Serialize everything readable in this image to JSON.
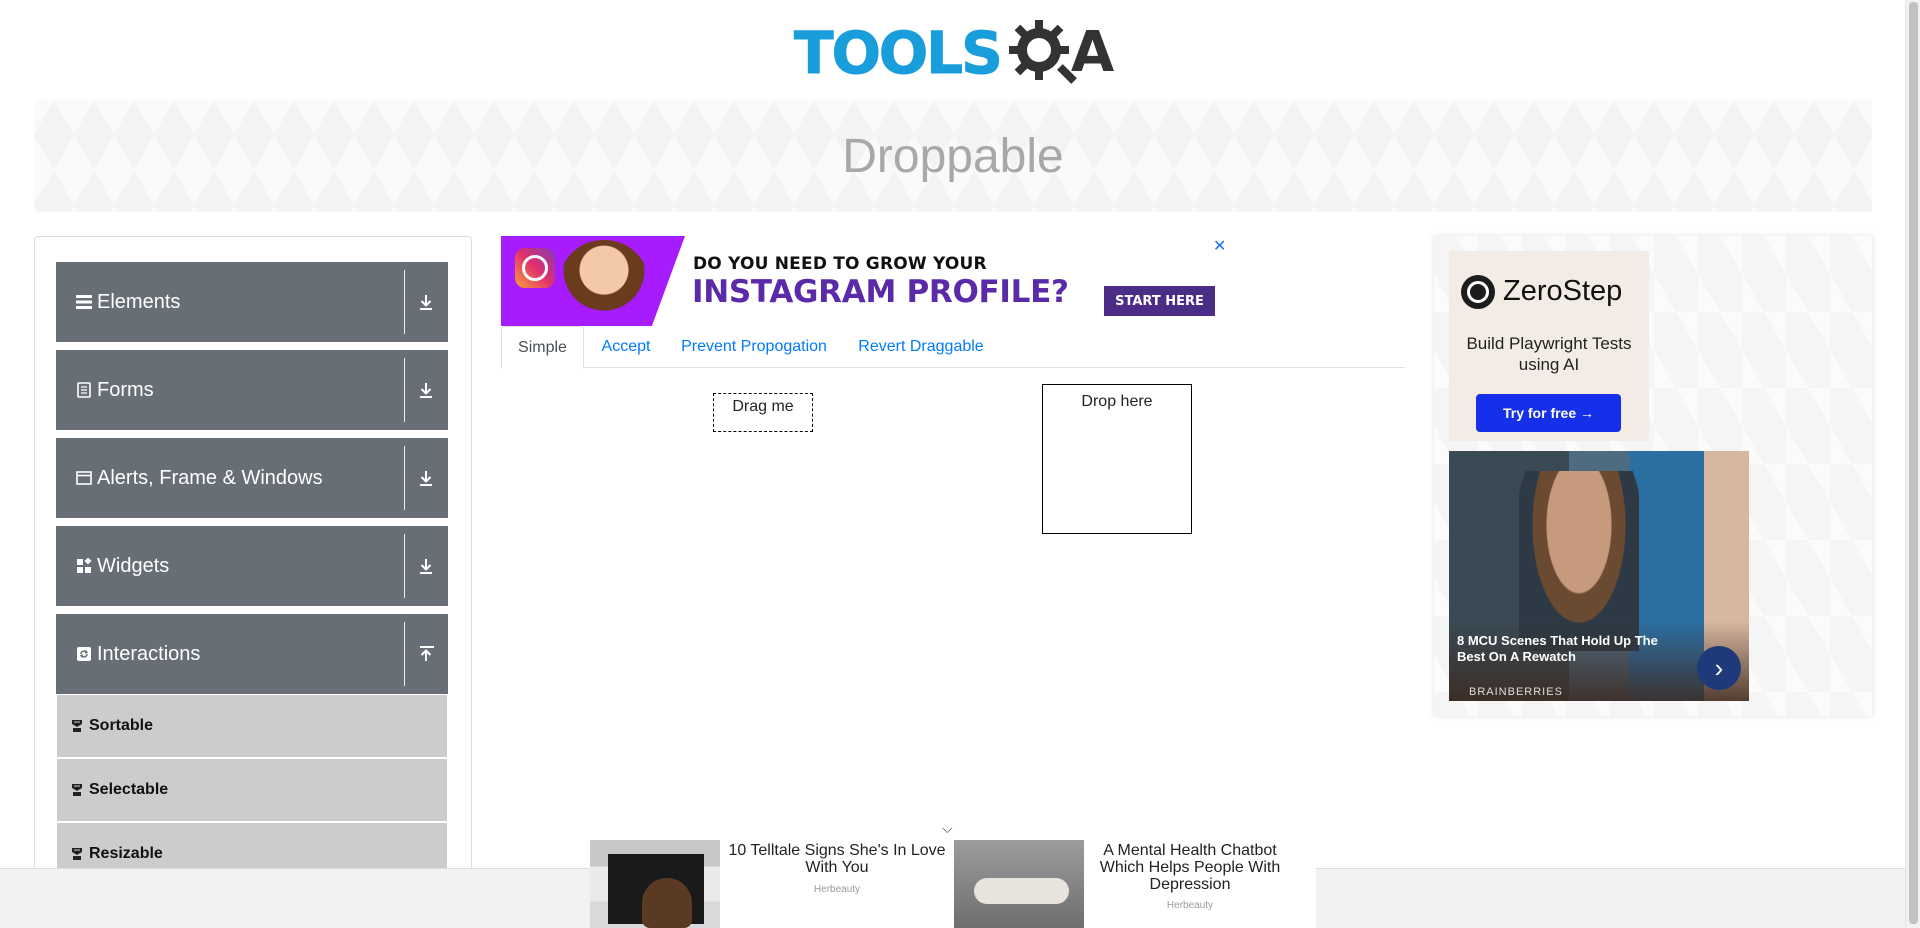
{
  "header": {
    "logo_tools": "TOOLS",
    "logo_a": "A",
    "page_title": "Droppable"
  },
  "sidebar": {
    "groups": [
      {
        "label": "Elements",
        "icon": "list-icon",
        "arrow": "download-icon"
      },
      {
        "label": "Forms",
        "icon": "document-icon",
        "arrow": "download-icon"
      },
      {
        "label": "Alerts, Frame & Windows",
        "icon": "window-icon",
        "arrow": "download-icon"
      },
      {
        "label": "Widgets",
        "icon": "widgets-icon",
        "arrow": "download-icon"
      },
      {
        "label": "Interactions",
        "icon": "refresh-icon",
        "arrow": "upload-icon"
      }
    ],
    "interactions": [
      {
        "label": "Sortable"
      },
      {
        "label": "Selectable"
      },
      {
        "label": "Resizable"
      }
    ]
  },
  "ad_top": {
    "line1": "DO YOU NEED TO GROW YOUR",
    "line2": "INSTAGRAM PROFILE?",
    "cta": "START HERE",
    "close": "✕"
  },
  "tabs": [
    {
      "label": "Simple",
      "active": true
    },
    {
      "label": "Accept",
      "active": false
    },
    {
      "label": "Prevent Propogation",
      "active": false
    },
    {
      "label": "Revert Draggable",
      "active": false
    }
  ],
  "simple": {
    "drag_label": "Drag me",
    "drop_label": "Drop here"
  },
  "ad_right": {
    "brand": "ZeroStep",
    "tagline": "Build Playwright Tests using AI",
    "cta": "Try for free →",
    "caption": "8 MCU Scenes That Hold Up The Best On A Rewatch",
    "source": "BRAINBERRIES",
    "next": "›"
  },
  "ad_bottom": {
    "chevron": "⌵",
    "items": [
      {
        "title": "10 Telltale Signs She's In Love With You",
        "source": "Herbeauty"
      },
      {
        "title": "A Mental Health Chatbot Which Helps People With Depression",
        "source": "Herbeauty"
      }
    ]
  },
  "colors": {
    "sidebar_group": "#676e75",
    "sidebar_item": "#cccccc",
    "tab_link": "#007bff",
    "brand_blue": "#1a9ddb"
  }
}
